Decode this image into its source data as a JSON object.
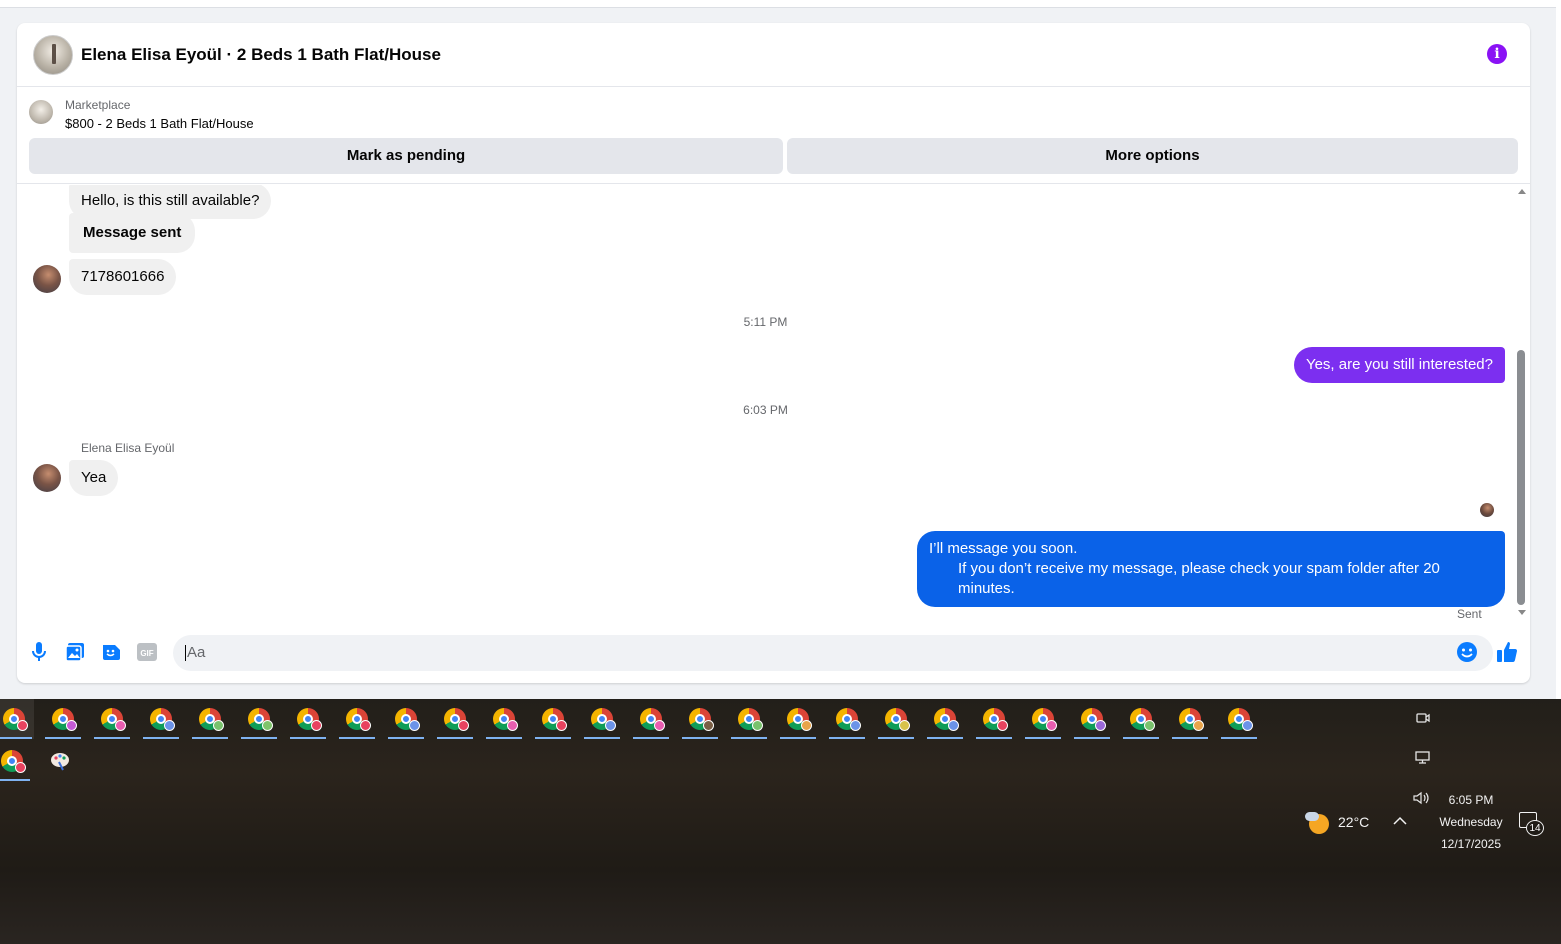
{
  "header": {
    "title": "Elena Elisa Eyoül · 2 Beds 1 Bath Flat/House",
    "info_icon": "info-icon"
  },
  "listing": {
    "source": "Marketplace",
    "summary": "$800 - 2 Beds 1 Bath Flat/House",
    "mark_pending": "Mark as pending",
    "more_options": "More options"
  },
  "messages": {
    "m1": "Hello, is this still available?",
    "m2": "Message sent",
    "m3": "7178601666",
    "time1": "5:11 PM",
    "m4": "Yes, are you still interested?",
    "time2": "6:03 PM",
    "sender": "Elena Elisa Eyoül",
    "m5": "Yea",
    "m6_line1": "I’ll message you soon.",
    "m6_line2": "If you don’t receive my message, please check your spam folder after 20 minutes.",
    "status": "Sent"
  },
  "composer": {
    "placeholder": "Aa"
  },
  "colors": {
    "outgoing_purple": "#7c2ff0",
    "outgoing_blue": "#0a62e8",
    "accent": "#0a7cff",
    "info": "#8a12f5"
  },
  "taskbar": {
    "row1_badges": [
      "#e8425f",
      "#c45ad6",
      "#e85db0",
      "#6b93e8",
      "#79c26d",
      "#7fc46c",
      "#e8425f",
      "#e8425f",
      "#6b93e8",
      "#e8425f",
      "#e85db0",
      "#e8425f",
      "#6b93e8",
      "#e85db0",
      "#7a5f45",
      "#79c26d",
      "#e8a44a",
      "#6b93e8",
      "#d8c24a",
      "#6b93e8",
      "#e8425f",
      "#e85db0",
      "#9a68d8",
      "#79c26d",
      "#e8a44a",
      "#6b93e8"
    ],
    "row2_badges": [
      "#e8425f"
    ],
    "weather_temp": "22°C",
    "time": "6:05 PM",
    "day": "Wednesday",
    "date": "12/17/2025",
    "notifications": "14"
  }
}
